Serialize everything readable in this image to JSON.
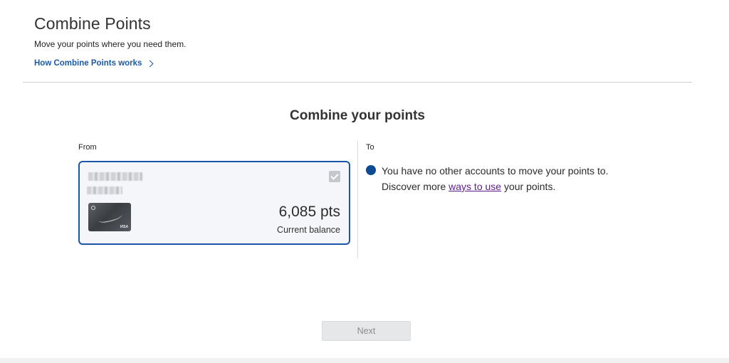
{
  "header": {
    "title": "Combine Points",
    "subtitle": "Move your points where you need them.",
    "how_link": "How Combine Points works"
  },
  "main": {
    "section_title": "Combine your points",
    "from": {
      "label": "From",
      "card": {
        "points": "6,085 pts",
        "balance_label": "Current balance",
        "selected": true
      }
    },
    "to": {
      "label": "To",
      "message_line1": "You have no other accounts to move your points to.",
      "message_pre": "Discover more ",
      "message_link": "ways to use",
      "message_post": " your points."
    }
  },
  "actions": {
    "next_label": "Next"
  },
  "colors": {
    "accent": "#1b56a6",
    "link": "#1a5aa6",
    "visited_link": "#5b1d8b",
    "indicator": "#0e4a92"
  },
  "icons": [
    "chevron-right-icon",
    "checkbox-checked-icon",
    "status-dot-icon"
  ]
}
